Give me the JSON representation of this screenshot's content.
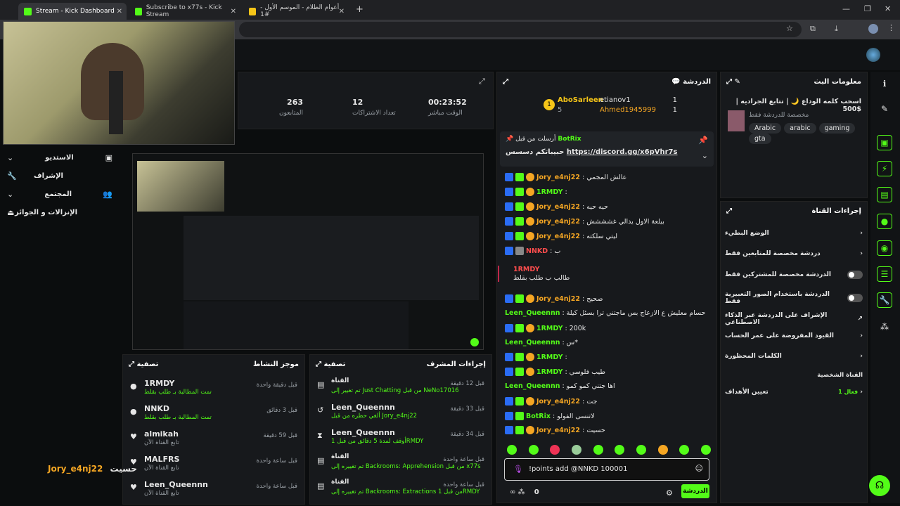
{
  "browser": {
    "tabs": [
      {
        "label": "Stream - Kick Dashboard"
      },
      {
        "label": "Subscribe to x77s - Kick Stream"
      },
      {
        "label": "أعوام الظلام - الموسم الأول - #1"
      }
    ],
    "new_tab": "+",
    "window": {
      "minimize": "—",
      "restore": "❐",
      "close": "✕"
    }
  },
  "stats": {
    "viewers_value": "263",
    "viewers_label": "المتابعون",
    "subs_value": "12",
    "subs_label": "تعداد الاشتراكات",
    "time_value": "00:23:52",
    "time_label": "الوقت مباشر"
  },
  "left_nav": [
    {
      "label": "الاستديو"
    },
    {
      "label": "الإشراف"
    },
    {
      "label": "المجتمع"
    },
    {
      "label": "الإنزالات و الجوائز"
    }
  ],
  "activity": {
    "title": "موجز النشاط",
    "filter": "تصفية",
    "items": [
      {
        "user": "1RMDY",
        "desc": "تمت المطالبة بـ طلب بقلط",
        "time": "قبل دقيقة واحدة"
      },
      {
        "user": "NNKD",
        "desc": "تمت المطالبة بـ طلب بقلط",
        "time": "قبل 3 دقائق"
      },
      {
        "user": "almikah",
        "desc": "تابع القناة الآن",
        "time": "قبل 59 دقيقة"
      },
      {
        "user": "MALFRS",
        "desc": "تابع القناة الآن",
        "time": "قبل ساعة واحدة"
      },
      {
        "user": "Leen_Queennn",
        "desc": "تابع القناة الآن",
        "time": "قبل ساعة واحدة"
      }
    ]
  },
  "mod_actions": {
    "title": "إجراءات المشرف",
    "filter": "تصفية",
    "items": [
      {
        "user": "القناة",
        "desc": "تم تغيير إلى Just Chatting من قبل NeNo17016",
        "time": "قبل 12 دقيقة"
      },
      {
        "user": "Leen_Queennn",
        "desc": "ألغي حظره من قبل Jory_e4nj22",
        "time": "قبل 33 دقيقة"
      },
      {
        "user": "Leen_Queennn",
        "desc": "أوقف لمدة 5 دقائق من قبل 1RMDY",
        "time": "قبل 34 دقيقة"
      },
      {
        "user": "القناة",
        "desc": "تم تغييره إلى Backrooms: Apprehension من قبل x77s",
        "time": "قبل ساعة واحدة"
      },
      {
        "user": "القناة",
        "desc": "تم تغييره إلى Backrooms: Extractions من قبل 1RMDY",
        "time": "قبل ساعة واحدة"
      }
    ]
  },
  "overlay_caption": {
    "user": "Jory_e4nj22",
    "text": "حسيت"
  },
  "chat": {
    "title": "الدردشة",
    "top_gifters": [
      {
        "rank": "1",
        "name": "AboSarleen",
        "count": "5"
      },
      {
        "name": "etianov1",
        "count": "1"
      },
      {
        "name": "Ahmed1945999",
        "count": "1"
      }
    ],
    "pinned": {
      "from": "أرسلت من قبل",
      "bot": "BotRix",
      "text": "حبيباتكم دسسس",
      "link": "https://discord.gg/x6pVhr7s"
    },
    "messages": [
      {
        "user": "Jory_e4nj22",
        "text": "عالش المجمي",
        "color": "#f5a623"
      },
      {
        "user": "1RMDY",
        "text": "",
        "color": "#53fc18"
      },
      {
        "user": "Jory_e4nj22",
        "text": "حيه حيه",
        "color": "#f5a623"
      },
      {
        "user": "Jory_e4nj22",
        "text": "بيلعة الاول يدالي غشششش",
        "color": "#f5a623"
      },
      {
        "user": "Jory_e4nj22",
        "text": "ليتي سلكته",
        "color": "#f5a623"
      },
      {
        "user": "NNKD",
        "text": "ب",
        "color": "#ff4d4d"
      },
      {
        "user": "1RMDY",
        "text": "طالب ب طلب بقلط",
        "color": "#ff4d4d"
      },
      {
        "user": "Jory_e4nj22",
        "text": "صحيح",
        "color": "#f5a623"
      },
      {
        "user": "Leen_Queennn",
        "text": "حسام معليش ع الازعاج بس ماجتني ترا بسئل كيلة",
        "color": "#53fc18"
      },
      {
        "user": "1RMDY",
        "text": "200k",
        "color": "#53fc18"
      },
      {
        "user": "Leen_Queennn",
        "text": "س*",
        "color": "#53fc18"
      },
      {
        "user": "1RMDY",
        "text": "",
        "color": "#53fc18"
      },
      {
        "user": "1RMDY",
        "text": "طيب فلوسي",
        "color": "#53fc18"
      },
      {
        "user": "Leen_Queennn",
        "text": "اها جتني كمو كمو",
        "color": "#53fc18"
      },
      {
        "user": "Jory_e4nj22",
        "text": "جت",
        "color": "#f5a623"
      },
      {
        "user": "BotRix",
        "text": "لاتنسى الفولو",
        "color": "#53fc18"
      },
      {
        "user": "Jory_e4nj22",
        "text": "حسيت",
        "color": "#f5a623"
      }
    ],
    "input_value": "!points add @NNKD 100001",
    "send_label": "الدردشة",
    "points": "0"
  },
  "stream_info": {
    "title": "معلومات البث",
    "stream_title": "اسحب كلمه الوداع 🌙 | تتابع الجراديه | 500$",
    "category": "مخصصة للدردشة فقط",
    "tags": [
      "Arabic",
      "arabic",
      "gaming",
      "gta"
    ]
  },
  "channel_actions": {
    "title": "إجراءات القناة",
    "items": [
      {
        "label": "الوضع البطيء",
        "type": "arrow"
      },
      {
        "label": "دردشة مخصصة للمتابعين فقط",
        "type": "arrow"
      },
      {
        "label": "الدردشة مخصصة للمشتركين فقط",
        "type": "toggle"
      },
      {
        "label": "الدردشة باستخدام الصور التعبيرية فقط",
        "type": "toggle"
      },
      {
        "label": "الإشراف على الدردشة عبر الذكاء الاصطناعي",
        "type": "ext"
      },
      {
        "label": "القيود المفروضة على عمر الحساب",
        "type": "arrow"
      },
      {
        "label": "الكلمات المحظورة",
        "type": "arrow"
      },
      {
        "label": "القناة الشخصية",
        "type": "none"
      },
      {
        "label": "تعيين الأهداف",
        "type": "goal",
        "extra": "1 فعال"
      }
    ]
  },
  "colors": {
    "kick_green": "#53fc18",
    "panel": "#17191c",
    "bg": "#0b0d0e"
  }
}
